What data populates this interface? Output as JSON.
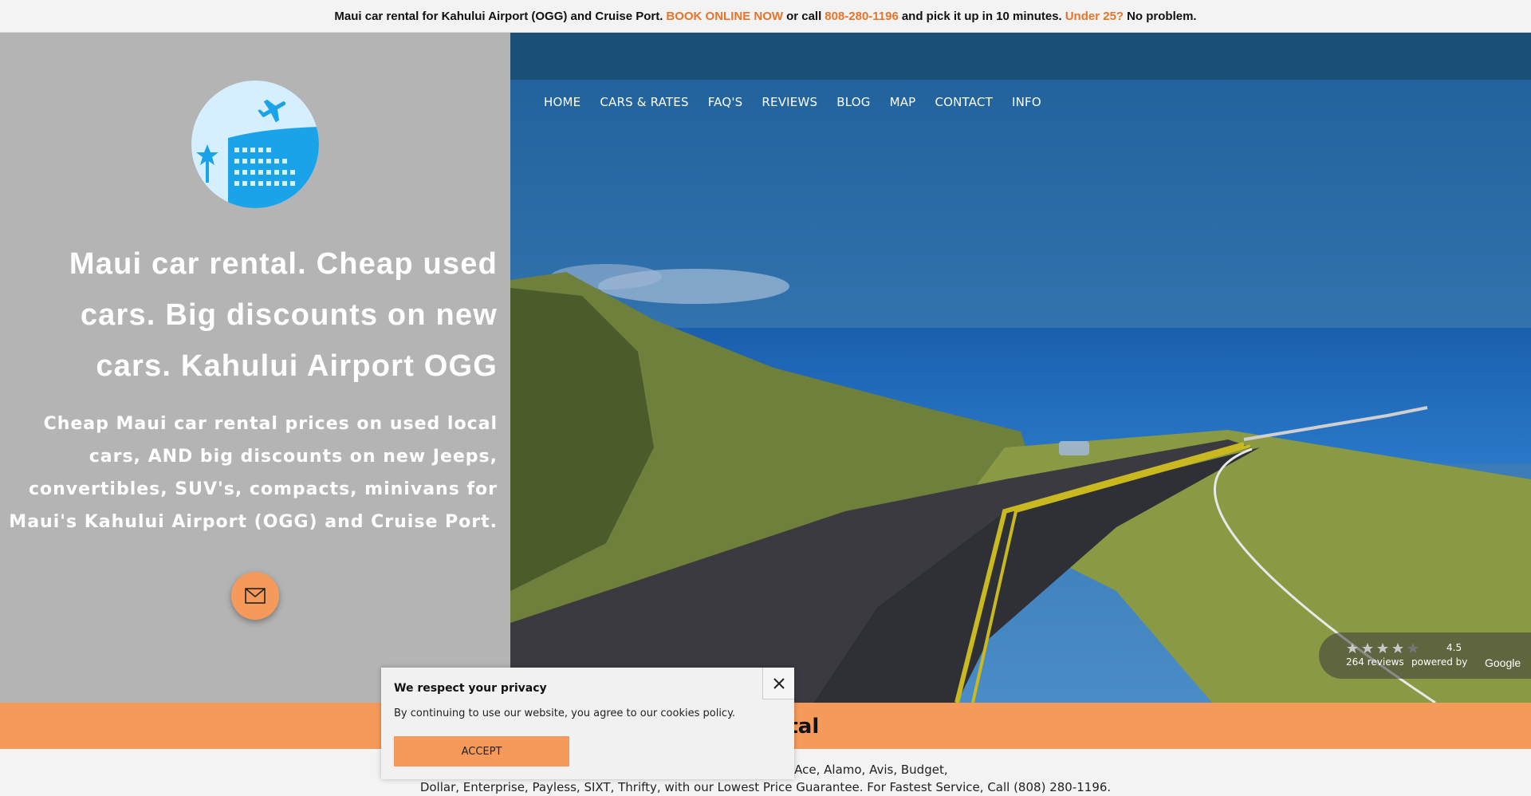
{
  "announcement": {
    "part1": "Maui car rental for Kahului Airport (OGG) and Cruise Port.",
    "book_link": "BOOK ONLINE NOW",
    "part2": "or call",
    "phone_link": "808-280-1196",
    "part3": "and pick it up in 10 minutes.",
    "under25_link": "Under 25?",
    "part4": "No problem."
  },
  "hero_left": {
    "headline": "Maui car rental. Cheap used cars. Big discounts on new cars. Kahului Airport OGG",
    "subheadline": "Cheap Maui car rental prices on used local cars, AND big discounts on new Jeeps, convertibles, SUV's, compacts, minivans for Maui's Kahului Airport (OGG) and Cruise Port."
  },
  "nav": {
    "items": [
      "HOME",
      "CARS & RATES",
      "FAQ'S",
      "REVIEWS",
      "BLOG",
      "MAP",
      "CONTACT",
      "INFO"
    ]
  },
  "reviews_widget": {
    "rating": "4.5",
    "count": "264 reviews",
    "powered_by": "powered by",
    "brand": "Google"
  },
  "section": {
    "title_visible": "ar Rental"
  },
  "body": {
    "line1": "d book top deals on new cars from Ace, Alamo, Avis, Budget,",
    "line2": "Dollar, Enterprise, Payless, SIXT, Thrifty, with our Lowest Price Guarantee. For Fastest Service, Call (808) 280-1196."
  },
  "cookie": {
    "title": "We respect your privacy",
    "text": "By continuing to use our website, you agree to our cookies policy.",
    "accept": "ACCEPT"
  },
  "colors": {
    "accent_orange": "#f59a5a",
    "link_orange": "#e8742a",
    "left_panel_gray": "#b4b4b4"
  }
}
